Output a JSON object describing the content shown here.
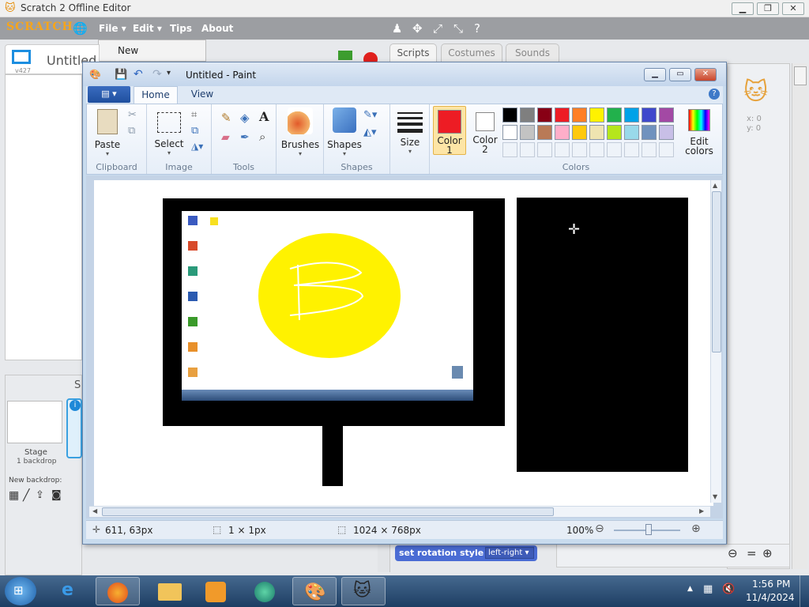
{
  "scratch": {
    "window_title": "Scratch 2 Offline Editor",
    "logo": "SCRATCH",
    "menus": [
      "File",
      "Edit",
      "Tips",
      "About"
    ],
    "file_dropdown_item": "New",
    "project_title": "Untitled",
    "version": "v427",
    "tabs": [
      "Scripts",
      "Costumes",
      "Sounds"
    ],
    "sprite_x": "x: 0",
    "sprite_y": "y: 0",
    "stage_label": "Stage",
    "stage_backdrops": "1 backdrop",
    "new_backdrop": "New backdrop:",
    "sprites_header_initial": "S",
    "block": {
      "part1": "set",
      "part2": "rotation",
      "part3": "style",
      "option": "left-right"
    }
  },
  "paint": {
    "window_title": "Untitled - Paint",
    "ribbon_tabs": [
      "Home",
      "View"
    ],
    "groups": {
      "clipboard": "Clipboard",
      "image": "Image",
      "tools": "Tools",
      "shapes": "Shapes",
      "colors": "Colors"
    },
    "buttons": {
      "paste": "Paste",
      "select": "Select",
      "brushes": "Brushes",
      "shapes": "Shapes",
      "size": "Size",
      "color1_a": "Color",
      "color1_b": "1",
      "color2_a": "Color",
      "color2_b": "2",
      "edit_a": "Edit",
      "edit_b": "colors"
    },
    "color1": "#ed1c24",
    "color2": "#ffffff",
    "palette_row1": [
      "#000000",
      "#7f7f7f",
      "#880015",
      "#ed1c24",
      "#ff7f27",
      "#fff200",
      "#22b14c",
      "#00a2e8",
      "#3f48cc",
      "#a349a4"
    ],
    "palette_row2": [
      "#ffffff",
      "#c3c3c3",
      "#b97a57",
      "#ffaec9",
      "#ffc90e",
      "#efe4b0",
      "#b5e61d",
      "#99d9ea",
      "#7092be",
      "#c8bfe7"
    ],
    "status": {
      "cursor": "611, 63px",
      "selection": "1 × 1px",
      "size": "1024 × 768px",
      "zoom": "100%"
    }
  },
  "taskbar": {
    "time": "1:56 PM",
    "date": "11/4/2024"
  }
}
